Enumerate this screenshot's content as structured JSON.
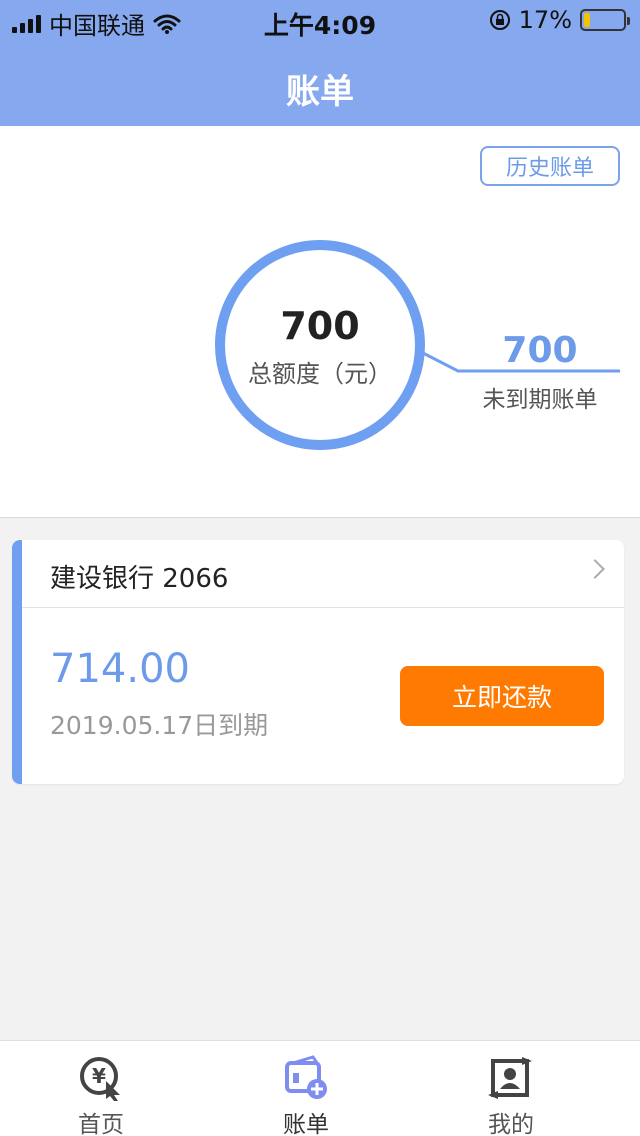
{
  "status_bar": {
    "carrier": "中国联通",
    "time": "上午4:09",
    "battery_percent": "17%",
    "battery_level": 0.17
  },
  "header": {
    "title": "账单"
  },
  "summary": {
    "history_button": "历史账单",
    "total_value": "700",
    "total_label": "总额度（元）",
    "pending_value": "700",
    "pending_label": "未到期账单"
  },
  "bill": {
    "bank": "建设银行 2066",
    "amount": "714.00",
    "due_text": "2019.05.17日到期",
    "repay_button": "立即还款"
  },
  "tabbar": {
    "items": [
      {
        "label": "首页",
        "icon": "yuan-cursor-icon"
      },
      {
        "label": "账单",
        "icon": "card-add-icon"
      },
      {
        "label": "我的",
        "icon": "profile-frame-icon"
      }
    ]
  },
  "colors": {
    "header_bg": "#86a8ee",
    "accent_blue": "#6f9ff0",
    "repay_orange": "#ff7a00",
    "page_bg": "#f2f2f2"
  }
}
